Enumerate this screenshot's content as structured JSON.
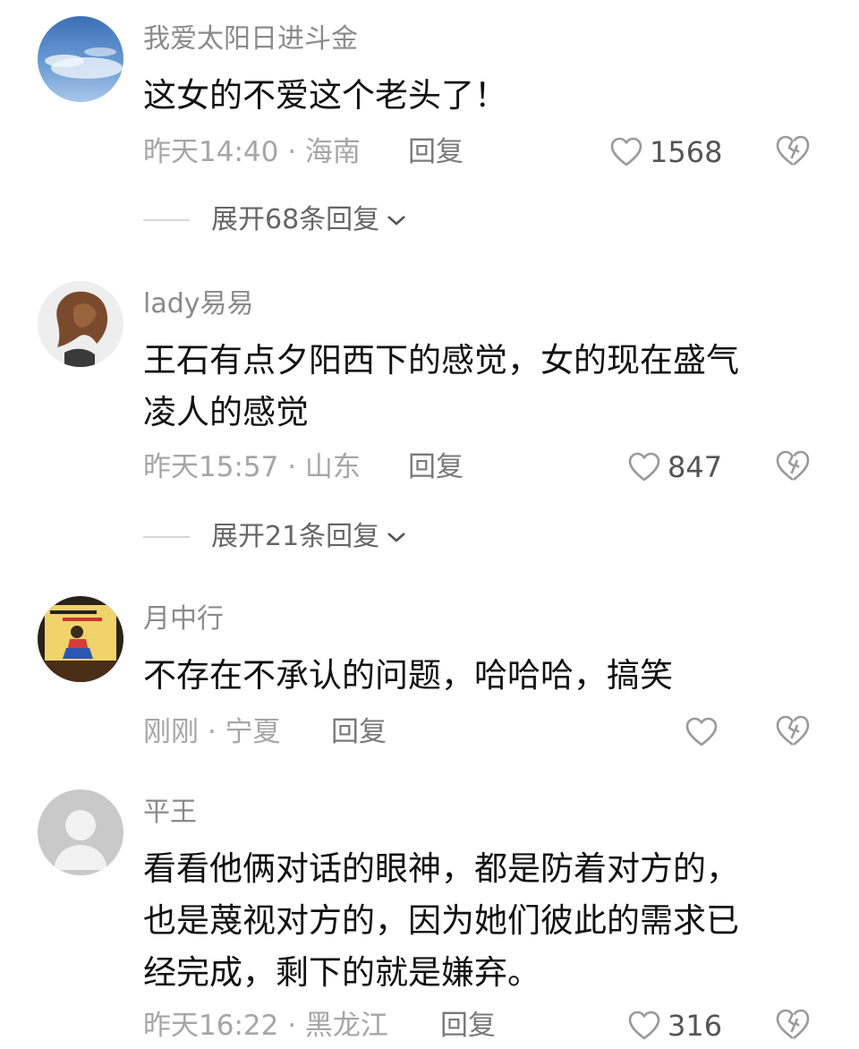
{
  "comments": [
    {
      "avatar": "sky-avatar",
      "username": "我爱太阳日进斗金",
      "lines": [
        "这女的不爱这个老头了！"
      ],
      "meta": "昨天14:40 · 海南",
      "reply_label": "回复",
      "likes": "1568",
      "expand_label": "展开68条回复"
    },
    {
      "avatar": "woman-hair-avatar",
      "username": "lady易易",
      "lines": [
        "王石有点夕阳西下的感觉，女的现在盛气",
        "凌人的感觉"
      ],
      "meta": "昨天15:57 · 山东",
      "reply_label": "回复",
      "likes": "847",
      "expand_label": "展开21条回复"
    },
    {
      "avatar": "cartoon-poster-avatar",
      "username": "月中行",
      "lines": [
        "不存在不承认的问题，哈哈哈，搞笑"
      ],
      "meta": "刚刚 · 宁夏",
      "reply_label": "回复",
      "likes": "",
      "expand_label": ""
    },
    {
      "avatar": "default-user-avatar",
      "username": "平王",
      "lines": [
        "看看他俩对话的眼神，都是防着对方的，",
        "也是蔑视对方的，因为她们彼此的需求已",
        "经完成，剩下的就是嫌弃。"
      ],
      "meta": "昨天16:22 · 黑龙江",
      "reply_label": "回复",
      "likes": "316",
      "expand_label": ""
    }
  ],
  "colors": {
    "username": "#8a8a8a",
    "meta": "#a6a6a6",
    "icon": "#9a9a9a"
  }
}
